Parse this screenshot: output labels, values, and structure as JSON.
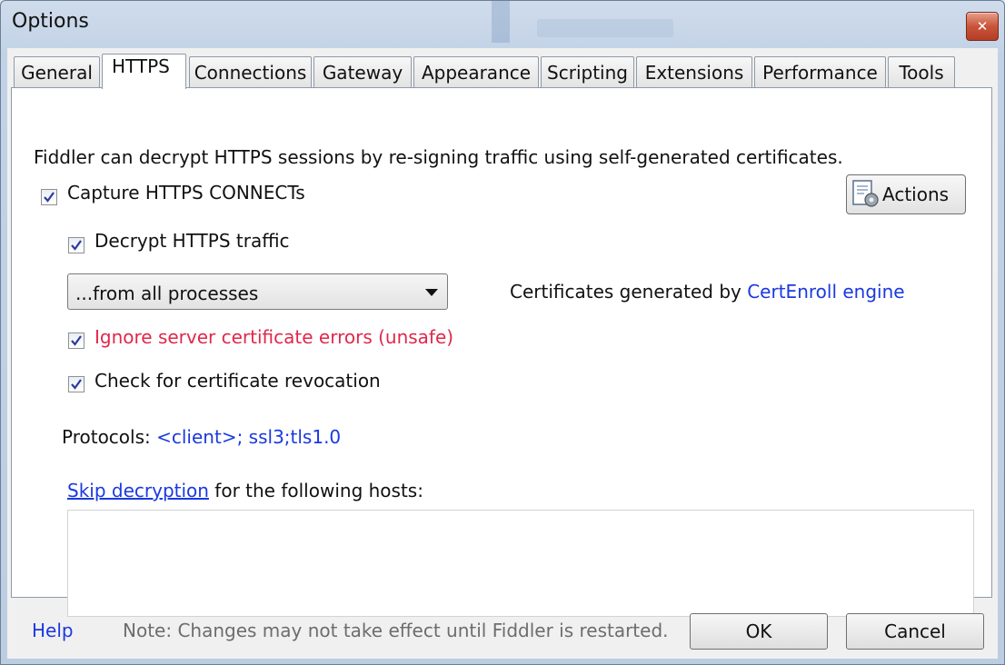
{
  "window": {
    "title": "Options",
    "close_symbol": "✕"
  },
  "tabs": [
    {
      "label": "General"
    },
    {
      "label": "HTTPS",
      "active": true
    },
    {
      "label": "Connections"
    },
    {
      "label": "Gateway"
    },
    {
      "label": "Appearance"
    },
    {
      "label": "Scripting"
    },
    {
      "label": "Extensions"
    },
    {
      "label": "Performance"
    },
    {
      "label": "Tools"
    }
  ],
  "https": {
    "intro": "Fiddler can decrypt HTTPS sessions by re-signing traffic using self-generated certificates.",
    "capture_label": "Capture HTTPS CONNECTs",
    "capture_checked": true,
    "actions_label": "Actions",
    "decrypt_label": "Decrypt HTTPS traffic",
    "decrypt_checked": true,
    "process_filter": "...from all processes",
    "cert_prefix": "Certificates generated by ",
    "cert_engine": "CertEnroll engine",
    "ignore_errors_label": "Ignore server certificate errors (unsafe)",
    "ignore_errors_checked": true,
    "revocation_label": "Check for certificate revocation",
    "revocation_checked": true,
    "protocols_prefix": "Protocols: ",
    "protocols_value": "<client>; ssl3;tls1.0",
    "skip_link": "Skip decryption",
    "skip_suffix": " for the following hosts:",
    "hosts_value": ""
  },
  "footer": {
    "help": "Help",
    "note": "Note: Changes may not take effect until Fiddler is restarted.",
    "ok": "OK",
    "cancel": "Cancel"
  },
  "colors": {
    "link": "#1a39e0",
    "warning": "#e0284a",
    "close_button": "#c8553a"
  },
  "icons": [
    "close-icon",
    "actions-icon",
    "check-icon",
    "dropdown-arrow-icon"
  ]
}
